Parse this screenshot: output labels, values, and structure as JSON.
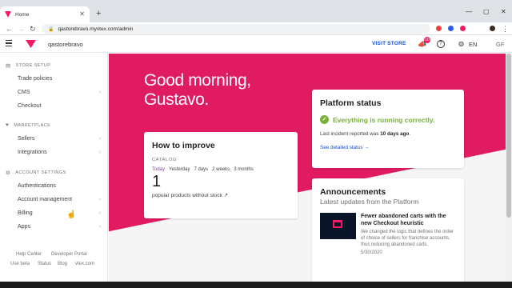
{
  "browser": {
    "tab_title": "Home",
    "tab_close": "✕",
    "new_tab": "+",
    "url": "qastorebravo.myvtex.com/admin",
    "win_min": "—",
    "win_max": "▢",
    "win_close": "✕",
    "back": "←",
    "forward": "→",
    "reload": "↻"
  },
  "header": {
    "store_name": "qastorebravo",
    "visit_store": "VISIT STORE",
    "notifications_count": "10",
    "language": "EN",
    "user_initials": "GF"
  },
  "sidebar": {
    "store_setup": {
      "title": "STORE SETUP",
      "items": [
        "Trade policies",
        "CMS",
        "Checkout"
      ]
    },
    "marketplace": {
      "title": "MARKETPLACE",
      "items": [
        "Sellers",
        "Integrations"
      ]
    },
    "account_settings": {
      "title": "ACCOUNT SETTINGS",
      "items": [
        "Authentications",
        "Account management",
        "Billing",
        "Apps"
      ]
    },
    "footer": {
      "help_center": "Help Center",
      "developer_portal": "Developer Portal",
      "use_beta": "Use beta",
      "status": "Status",
      "blog": "Blog",
      "vtex": "vtex.com"
    }
  },
  "main": {
    "greeting_line1": "Good morning,",
    "greeting_line2": "Gustavo.",
    "how_to_improve": {
      "title": "How to improve",
      "category": "CATALOG",
      "periods": [
        "Today",
        "Yesterday",
        "7 days",
        "2 weeks",
        "3 months"
      ],
      "active_period": "Today",
      "value": "1",
      "metric": "popular products without stock ↗"
    },
    "platform_status": {
      "title": "Platform status",
      "status_text": "Everything is running correctly.",
      "incident_prefix": "Last incident reported was",
      "incident_time": "10 days ago",
      "incident_suffix": ".",
      "detail_link": "See detailed status →"
    },
    "announcements": {
      "title": "Announcements",
      "subtitle": "Latest updates from the Platform",
      "item": {
        "headline": "Fewer abandoned carts with the new Checkout heuristic",
        "body": "We changed the logic that defines the order of choice of sellers for franchise accounts, thus reducing abandoned carts.",
        "date": "5/30/2020"
      }
    }
  },
  "colors": {
    "brand_pink": "#e11b61",
    "success_green": "#79b03a",
    "link_blue": "#134cd8"
  }
}
